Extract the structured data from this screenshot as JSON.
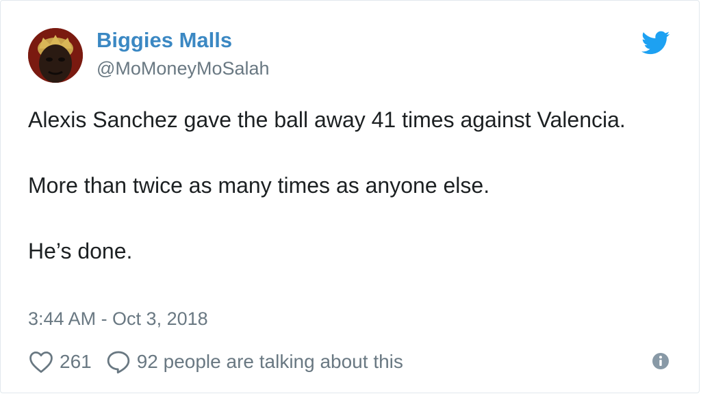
{
  "author": {
    "name": "Biggies Malls",
    "handle": "@MoMoneyMoSalah"
  },
  "tweet": {
    "paragraphs": [
      "Alexis Sanchez gave the ball away 41 times against Valencia.",
      "More than twice as many times as anyone else.",
      "He’s done."
    ],
    "timestamp": "3:44 AM - Oct 3, 2018"
  },
  "actions": {
    "likes": "261",
    "conversation": "92 people are talking about this"
  },
  "icons": {
    "brand": "twitter-bird-icon",
    "like": "heart-icon",
    "reply": "speech-bubble-icon",
    "info": "info-icon"
  },
  "colors": {
    "name": "#3b88c3",
    "muted": "#697882",
    "text": "#1c2022",
    "twitter_blue": "#1da1f2"
  }
}
